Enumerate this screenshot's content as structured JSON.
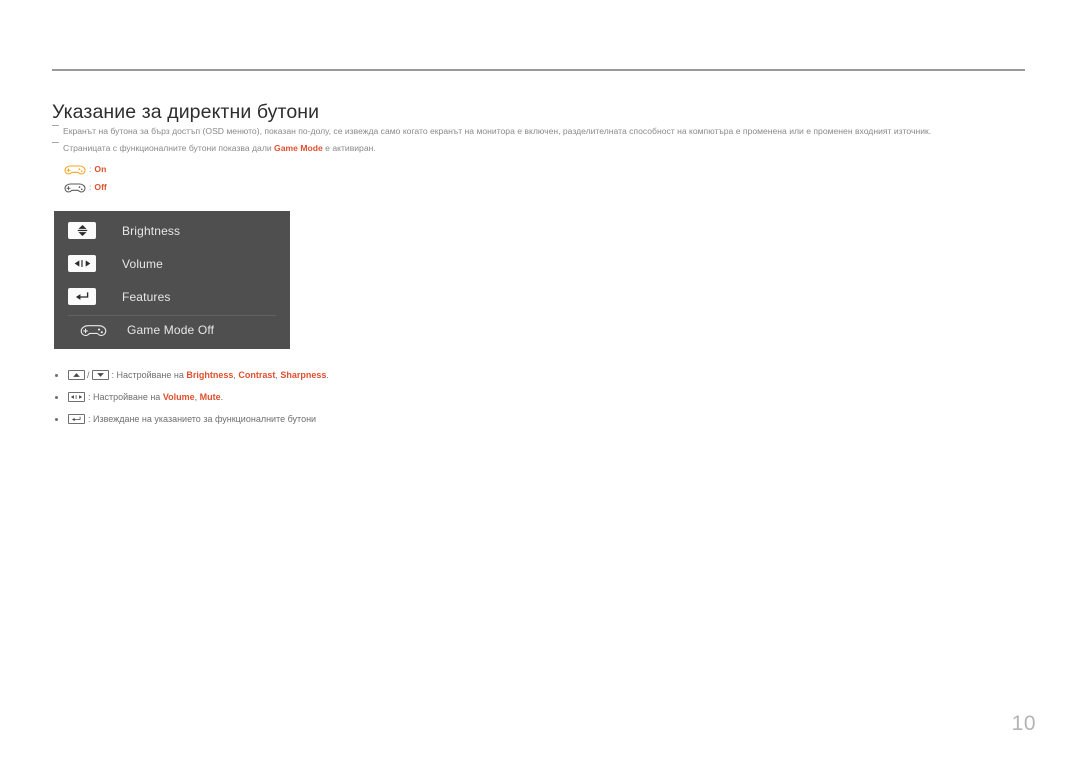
{
  "document": {
    "page_number": "10",
    "title": "Указание за директни бутони"
  },
  "notes": [
    {
      "id": "note-osd",
      "text": "Екранът на бутона за бърз достъп (OSD менюто), показан по-долу, се извежда само когато екранът на монитора е включен, разделителната способност на компютъра е променена или е променен входният източник."
    },
    {
      "id": "note-game-mode",
      "prefix": "Страницата с функционалните бутони показва дали ",
      "highlight": "Game Mode",
      "suffix": " е активиран."
    }
  ],
  "legend": {
    "separator": ":",
    "rows": [
      {
        "icon": "gamepad-icon",
        "state": "On",
        "icon_color": "#f5a623"
      },
      {
        "icon": "gamepad-icon",
        "state": "Off",
        "icon_color": "#5a5a5a"
      }
    ]
  },
  "osd_menu": {
    "background_color": "#4f4f4f",
    "items": [
      {
        "icon": "up-down-arrow-icon",
        "label": "Brightness"
      },
      {
        "icon": "left-right-arrow-icon",
        "label": "Volume"
      },
      {
        "icon": "enter-arrow-icon",
        "label": "Features"
      }
    ],
    "footer": {
      "icon": "gamepad-icon",
      "label": "Game Mode Off"
    }
  },
  "shortcuts": [
    {
      "keys": [
        "up-arrow-key",
        "down-arrow-key"
      ],
      "separator": "/",
      "text_prefix": ": Настройване на ",
      "values": [
        "Brightness",
        "Contrast",
        "Sharpness"
      ],
      "text_suffix": "."
    },
    {
      "keys": [
        "left-right-arrow-key"
      ],
      "separator": "",
      "text_prefix": ": Настройване на ",
      "values": [
        "Volume",
        "Mute"
      ],
      "text_suffix": "."
    },
    {
      "keys": [
        "enter-arrow-key"
      ],
      "separator": "",
      "text_prefix": ": Извеждане на указанието за функционалните бутони",
      "values": [],
      "text_suffix": ""
    }
  ],
  "colors": {
    "accent": "#e0502f",
    "gamepad_on": "#f5a623",
    "rule": "#9a9a9a",
    "osd_panel": "#4f4f4f",
    "page_number": "#b4b4b4"
  }
}
